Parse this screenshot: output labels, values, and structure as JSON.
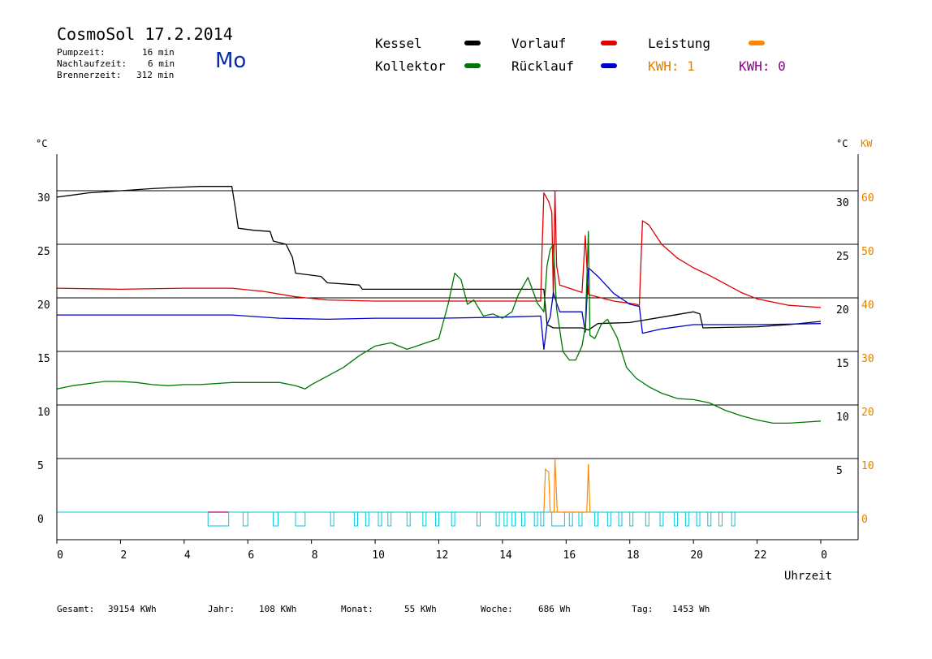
{
  "header": {
    "title": "CosmoSol 17.2.2014",
    "weekday": "Mo",
    "stats": [
      {
        "label": "Pumpzeit:",
        "value": "16 min"
      },
      {
        "label": "Nachlaufzeit:",
        "value": "6 min"
      },
      {
        "label": "Brennerzeit:",
        "value": "312 min"
      }
    ]
  },
  "legend": {
    "kessel": "Kessel",
    "kollektor": "Kollektor",
    "vorlauf": "Vorlauf",
    "ruecklauf": "Rücklauf",
    "leistung": "Leistung",
    "kwh1": "KWH: 1",
    "kwh0": "KWH: 0"
  },
  "colors": {
    "kessel": "#000000",
    "kollektor": "#007700",
    "vorlauf": "#dd0000",
    "ruecklauf": "#0000cc",
    "leistung": "#ff8800",
    "kwh1": "#e08000",
    "kwh0": "#880088",
    "pump": "#00c8e0",
    "pumpStart": "#cc66aa"
  },
  "footer": {
    "gesamt_label": "Gesamt:",
    "gesamt_value": "39154 KWh",
    "jahr_label": "Jahr:",
    "jahr_value": "108 KWh",
    "monat_label": "Monat:",
    "monat_value": "55 KWh",
    "woche_label": "Woche:",
    "woche_value": "686 Wh",
    "tag_label": "Tag:",
    "tag_value": "1453 Wh"
  },
  "chart_data": {
    "type": "line",
    "xlabel": "Uhrzeit",
    "xlim": [
      0,
      24
    ],
    "xticks": [
      0,
      2,
      4,
      6,
      8,
      10,
      12,
      14,
      16,
      18,
      20,
      22,
      24
    ],
    "xtick_labels": [
      "0",
      "2",
      "4",
      "6",
      "8",
      "10",
      "12",
      "14",
      "16",
      "18",
      "20",
      "22",
      "0"
    ],
    "left_axis": {
      "unit": "°C",
      "ticks": [
        0,
        5,
        10,
        15,
        20,
        25,
        30
      ],
      "ylim": [
        -2.5,
        33.5
      ]
    },
    "right_axis": {
      "unit": "°C",
      "unit2": "KW",
      "ticks": [
        5,
        10,
        15,
        20,
        25,
        30
      ],
      "kw_ticks": [
        0,
        10,
        20,
        30,
        40,
        50,
        60
      ]
    },
    "grid": "horizontal",
    "series": [
      {
        "name": "Kessel",
        "key": "kessel",
        "points": [
          [
            0,
            29.4
          ],
          [
            0.5,
            29.6
          ],
          [
            1,
            29.8
          ],
          [
            2,
            30.0
          ],
          [
            3,
            30.2
          ],
          [
            3.7,
            30.3
          ],
          [
            4.5,
            30.4
          ],
          [
            5.5,
            30.4
          ],
          [
            5.6,
            28.5
          ],
          [
            5.7,
            26.5
          ],
          [
            6.2,
            26.3
          ],
          [
            6.7,
            26.2
          ],
          [
            6.8,
            25.3
          ],
          [
            7.2,
            25.0
          ],
          [
            7.4,
            23.8
          ],
          [
            7.5,
            22.3
          ],
          [
            8.3,
            22.0
          ],
          [
            8.5,
            21.4
          ],
          [
            9.5,
            21.2
          ],
          [
            9.6,
            20.8
          ],
          [
            12,
            20.8
          ],
          [
            14,
            20.8
          ],
          [
            15.3,
            20.8
          ],
          [
            15.4,
            17.5
          ],
          [
            15.6,
            17.2
          ],
          [
            16.5,
            17.2
          ],
          [
            16.7,
            17.0
          ],
          [
            17,
            17.6
          ],
          [
            18,
            17.7
          ],
          [
            19,
            18.2
          ],
          [
            20,
            18.7
          ],
          [
            20.2,
            18.5
          ],
          [
            20.3,
            17.2
          ],
          [
            22,
            17.3
          ],
          [
            23,
            17.5
          ],
          [
            24,
            17.8
          ]
        ]
      },
      {
        "name": "Vorlauf",
        "key": "vorlauf",
        "points": [
          [
            0,
            20.9
          ],
          [
            2,
            20.8
          ],
          [
            4,
            20.9
          ],
          [
            5.5,
            20.9
          ],
          [
            6.5,
            20.6
          ],
          [
            7.5,
            20.1
          ],
          [
            8.5,
            19.8
          ],
          [
            10,
            19.7
          ],
          [
            12,
            19.7
          ],
          [
            14,
            19.7
          ],
          [
            15.2,
            19.7
          ],
          [
            15.25,
            25
          ],
          [
            15.3,
            29.8
          ],
          [
            15.45,
            29.0
          ],
          [
            15.55,
            28.0
          ],
          [
            15.6,
            20
          ],
          [
            15.65,
            30.0
          ],
          [
            15.7,
            23.0
          ],
          [
            15.8,
            21.2
          ],
          [
            16.5,
            20.5
          ],
          [
            16.6,
            25.8
          ],
          [
            16.7,
            20.3
          ],
          [
            17.5,
            19.7
          ],
          [
            18.2,
            19.4
          ],
          [
            18.3,
            19.3
          ],
          [
            18.4,
            27.2
          ],
          [
            18.6,
            26.8
          ],
          [
            19,
            25.0
          ],
          [
            19.5,
            23.7
          ],
          [
            20,
            22.8
          ],
          [
            20.5,
            22.1
          ],
          [
            21,
            21.3
          ],
          [
            21.5,
            20.5
          ],
          [
            22,
            19.9
          ],
          [
            23,
            19.3
          ],
          [
            24,
            19.1
          ]
        ]
      },
      {
        "name": "Rücklauf",
        "key": "ruecklauf",
        "points": [
          [
            0,
            18.4
          ],
          [
            2,
            18.4
          ],
          [
            4,
            18.4
          ],
          [
            5.5,
            18.4
          ],
          [
            7,
            18.1
          ],
          [
            8.5,
            18.0
          ],
          [
            10,
            18.1
          ],
          [
            12,
            18.1
          ],
          [
            14,
            18.2
          ],
          [
            15.2,
            18.3
          ],
          [
            15.3,
            15.2
          ],
          [
            15.4,
            17.5
          ],
          [
            15.5,
            18.2
          ],
          [
            15.6,
            20.5
          ],
          [
            15.7,
            19.5
          ],
          [
            15.8,
            18.7
          ],
          [
            16.5,
            18.7
          ],
          [
            16.6,
            16.8
          ],
          [
            16.7,
            22.8
          ],
          [
            17,
            22.0
          ],
          [
            17.5,
            20.4
          ],
          [
            18,
            19.4
          ],
          [
            18.3,
            19.2
          ],
          [
            18.4,
            16.7
          ],
          [
            19,
            17.1
          ],
          [
            20,
            17.5
          ],
          [
            21,
            17.5
          ],
          [
            22,
            17.5
          ],
          [
            24,
            17.6
          ]
        ]
      },
      {
        "name": "Kollektor",
        "key": "kollektor",
        "points": [
          [
            0,
            11.5
          ],
          [
            0.5,
            11.8
          ],
          [
            1,
            12.0
          ],
          [
            1.5,
            12.2
          ],
          [
            2,
            12.2
          ],
          [
            2.5,
            12.1
          ],
          [
            3,
            11.9
          ],
          [
            3.5,
            11.8
          ],
          [
            4,
            11.9
          ],
          [
            4.5,
            11.9
          ],
          [
            5,
            12.0
          ],
          [
            5.5,
            12.1
          ],
          [
            6,
            12.1
          ],
          [
            6.5,
            12.1
          ],
          [
            7,
            12.1
          ],
          [
            7.5,
            11.8
          ],
          [
            7.8,
            11.5
          ],
          [
            8,
            11.9
          ],
          [
            8.5,
            12.7
          ],
          [
            9,
            13.5
          ],
          [
            9.5,
            14.6
          ],
          [
            10,
            15.5
          ],
          [
            10.5,
            15.8
          ],
          [
            11,
            15.2
          ],
          [
            11.5,
            15.7
          ],
          [
            12,
            16.2
          ],
          [
            12.3,
            19.5
          ],
          [
            12.5,
            22.3
          ],
          [
            12.7,
            21.7
          ],
          [
            12.9,
            19.4
          ],
          [
            13.1,
            19.8
          ],
          [
            13.4,
            18.3
          ],
          [
            13.7,
            18.5
          ],
          [
            14,
            18.1
          ],
          [
            14.3,
            18.7
          ],
          [
            14.5,
            20.3
          ],
          [
            14.8,
            21.9
          ],
          [
            15.1,
            19.5
          ],
          [
            15.3,
            18.7
          ],
          [
            15.4,
            23.0
          ],
          [
            15.5,
            24.5
          ],
          [
            15.6,
            25.0
          ],
          [
            15.7,
            19.0
          ],
          [
            15.9,
            15.0
          ],
          [
            16.1,
            14.2
          ],
          [
            16.3,
            14.2
          ],
          [
            16.5,
            15.5
          ],
          [
            16.6,
            17.3
          ],
          [
            16.7,
            26.2
          ],
          [
            16.75,
            16.5
          ],
          [
            16.9,
            16.2
          ],
          [
            17.1,
            17.5
          ],
          [
            17.3,
            18.0
          ],
          [
            17.6,
            16.3
          ],
          [
            17.9,
            13.5
          ],
          [
            18.2,
            12.5
          ],
          [
            18.6,
            11.7
          ],
          [
            19,
            11.1
          ],
          [
            19.5,
            10.6
          ],
          [
            20,
            10.5
          ],
          [
            20.5,
            10.2
          ],
          [
            21,
            9.5
          ],
          [
            21.5,
            9.0
          ],
          [
            22,
            8.6
          ],
          [
            22.5,
            8.3
          ],
          [
            23,
            8.3
          ],
          [
            23.5,
            8.4
          ],
          [
            24,
            8.5
          ]
        ]
      }
    ],
    "leistung_kw": [
      [
        15.3,
        0
      ],
      [
        15.35,
        8
      ],
      [
        15.45,
        7.5
      ],
      [
        15.5,
        0
      ],
      [
        15.62,
        0
      ],
      [
        15.65,
        10
      ],
      [
        15.72,
        0
      ],
      [
        16.65,
        0
      ],
      [
        16.7,
        9
      ],
      [
        16.75,
        0
      ]
    ],
    "pump_on_intervals": [
      [
        4.75,
        5.4
      ],
      [
        5.85,
        6
      ],
      [
        6.8,
        6.95
      ],
      [
        7.5,
        7.8
      ],
      [
        8.6,
        8.7
      ],
      [
        9.35,
        9.45
      ],
      [
        9.7,
        9.8
      ],
      [
        10.1,
        10.2
      ],
      [
        10.4,
        10.5
      ],
      [
        11.0,
        11.1
      ],
      [
        11.5,
        11.6
      ],
      [
        11.9,
        12.0
      ],
      [
        12.4,
        12.5
      ],
      [
        13.2,
        13.3
      ],
      [
        13.8,
        13.9
      ],
      [
        14.05,
        14.15
      ],
      [
        14.3,
        14.4
      ],
      [
        14.6,
        14.7
      ],
      [
        15.0,
        15.1
      ],
      [
        15.2,
        15.3
      ],
      [
        15.55,
        15.95
      ],
      [
        16.1,
        16.2
      ],
      [
        16.4,
        16.5
      ],
      [
        16.9,
        17.0
      ],
      [
        17.3,
        17.4
      ],
      [
        17.65,
        17.75
      ],
      [
        18.0,
        18.1
      ],
      [
        18.5,
        18.6
      ],
      [
        18.95,
        19.05
      ],
      [
        19.4,
        19.5
      ],
      [
        19.75,
        19.85
      ],
      [
        20.1,
        20.2
      ],
      [
        20.45,
        20.55
      ],
      [
        20.8,
        20.9
      ],
      [
        21.2,
        21.3
      ]
    ]
  }
}
